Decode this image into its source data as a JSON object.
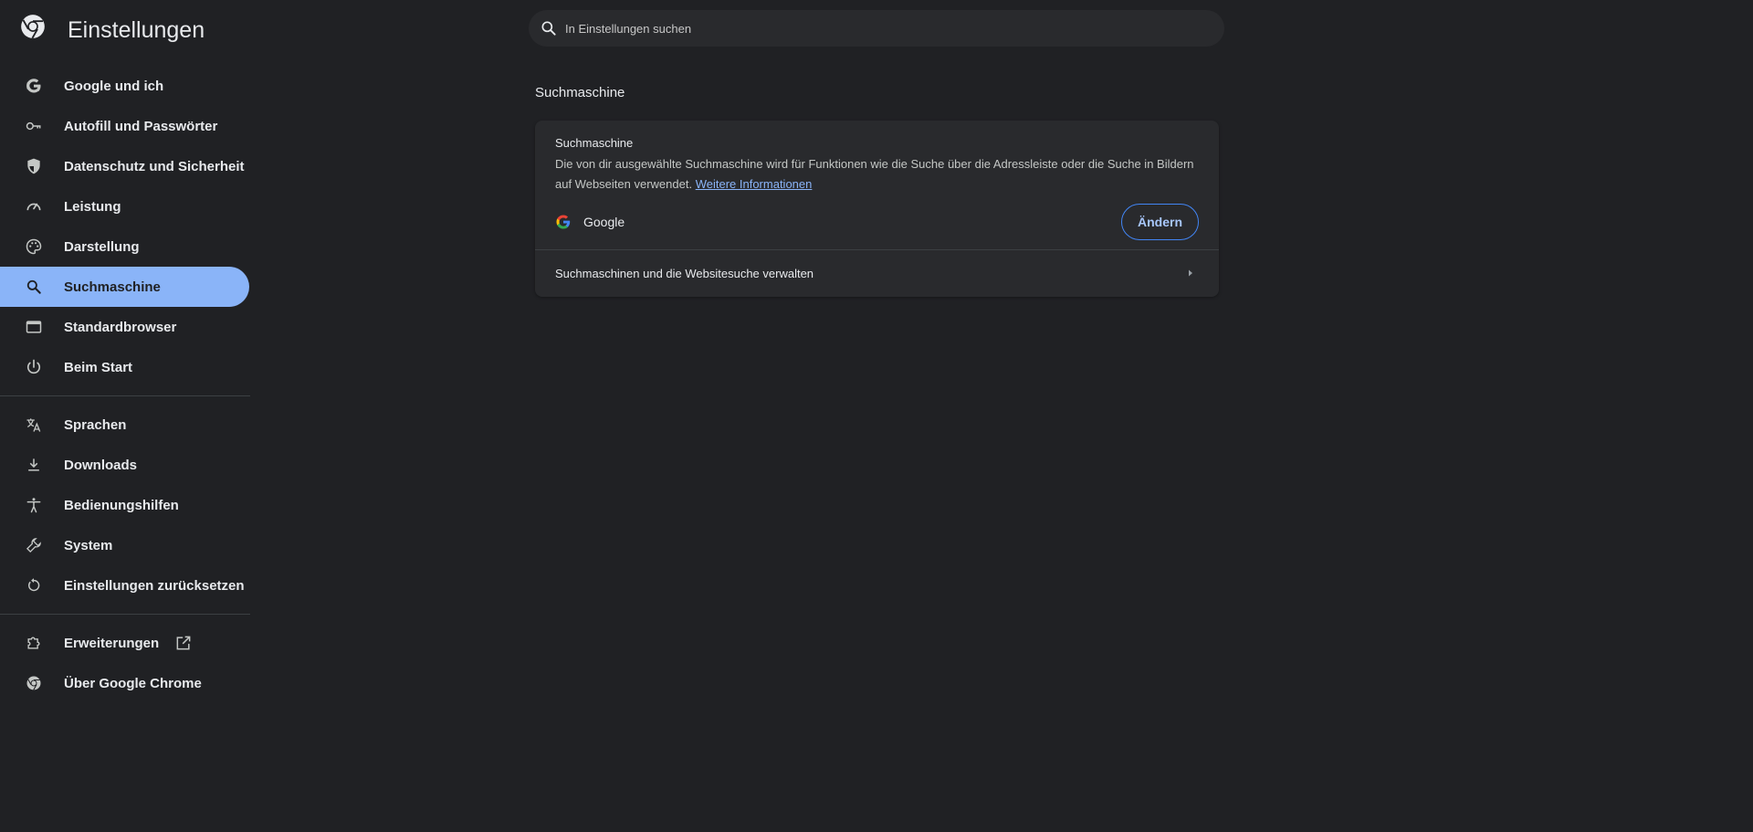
{
  "header": {
    "title": "Einstellungen",
    "search_placeholder": "In Einstellungen suchen"
  },
  "sidebar": {
    "items": [
      {
        "label": "Google und ich",
        "icon": "google-icon"
      },
      {
        "label": "Autofill und Passwörter",
        "icon": "key-icon"
      },
      {
        "label": "Datenschutz und Sicherheit",
        "icon": "shield-icon"
      },
      {
        "label": "Leistung",
        "icon": "speedometer-icon"
      },
      {
        "label": "Darstellung",
        "icon": "palette-icon"
      },
      {
        "label": "Suchmaschine",
        "icon": "search-icon",
        "active": true
      },
      {
        "label": "Standardbrowser",
        "icon": "browser-window-icon"
      },
      {
        "label": "Beim Start",
        "icon": "power-icon"
      }
    ],
    "items2": [
      {
        "label": "Sprachen",
        "icon": "translate-icon"
      },
      {
        "label": "Downloads",
        "icon": "download-icon"
      },
      {
        "label": "Bedienungshilfen",
        "icon": "accessibility-icon"
      },
      {
        "label": "System",
        "icon": "wrench-icon"
      },
      {
        "label": "Einstellungen zurücksetzen",
        "icon": "reset-icon"
      }
    ],
    "items3": [
      {
        "label": "Erweiterungen",
        "icon": "puzzle-icon",
        "external_icon": "open-in-new-icon"
      },
      {
        "label": "Über Google Chrome",
        "icon": "chrome-icon"
      }
    ]
  },
  "main": {
    "section_title": "Suchmaschine",
    "card": {
      "title": "Suchmaschine",
      "description": "Die von dir ausgewählte Suchmaschine wird für Funktionen wie die Suche über die Adressleiste oder die Suche in Bildern auf Webseiten verwendet.",
      "link": "Weitere Informationen",
      "engine_name": "Google",
      "change_button": "Ändern",
      "manage_label": "Suchmaschinen und die Websitesuche verwalten"
    }
  },
  "colors": {
    "background": "#202124",
    "accent": "#8ab4f8",
    "card": "#292a2d"
  }
}
